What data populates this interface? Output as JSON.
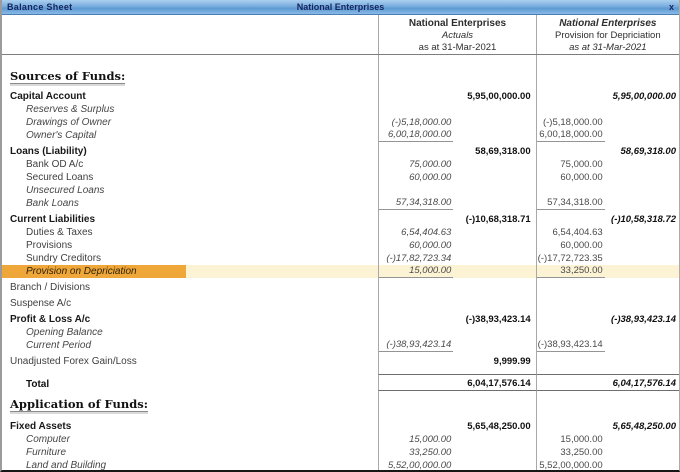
{
  "title_bar": {
    "left": "Balance Sheet",
    "center": "National Enterprises",
    "close": "x"
  },
  "columns": [
    {
      "line1": "National Enterprises",
      "line2": "Actuals",
      "line3": "as at 31-Mar-2021"
    },
    {
      "line1": "National Enterprises",
      "line2": "Provision for Depriciation",
      "line3": "as at 31-Mar-2021"
    }
  ],
  "colors": {
    "titlebar_blue": "#6aa2d8",
    "titlebar_text": "#16255d",
    "highlight_label_bg": "#f0a73a",
    "highlight_row_bg": "#fcf2d4",
    "grid_line": "#a8a8a8"
  },
  "rows": [
    {
      "label": "Sources of Funds:",
      "type": "section",
      "gap": 14
    },
    {
      "label": "Capital Account",
      "type": "group",
      "c1t": "5,95,00,000.00",
      "c2t": "5,95,00,000.00",
      "gap": 6
    },
    {
      "label": "Reserves & Surplus",
      "type": "ledger-italic",
      "gap": 0
    },
    {
      "label": "Drawings of Owner",
      "type": "ledger-italic",
      "c1d": "(-)5,18,000.00",
      "c2d": "(-)5,18,000.00",
      "gap": 0
    },
    {
      "label": "Owner's Capital",
      "type": "ledger-italic",
      "c1d": "6,00,18,000.00",
      "c2d": "6,00,18,000.00",
      "u": true,
      "gap": 0
    },
    {
      "label": "Loans (Liability)",
      "type": "group",
      "c1t": "58,69,318.00",
      "c2t": "58,69,318.00",
      "gap": 3
    },
    {
      "label": "Bank OD A/c",
      "type": "ledger",
      "c1d": "75,000.00",
      "c2d": "75,000.00",
      "gap": 0
    },
    {
      "label": "Secured Loans",
      "type": "ledger",
      "c1d": "60,000.00",
      "c2d": "60,000.00",
      "gap": 0
    },
    {
      "label": "Unsecured Loans",
      "type": "ledger-italic",
      "gap": 0
    },
    {
      "label": "Bank Loans",
      "type": "ledger-italic",
      "c1d": "57,34,318.00",
      "c2d": "57,34,318.00",
      "u": true,
      "gap": 0
    },
    {
      "label": "Current Liabilities",
      "type": "group",
      "c1t": "(-)10,68,318.71",
      "c2t": "(-)10,58,318.72",
      "gap": 3
    },
    {
      "label": "Duties & Taxes",
      "type": "ledger",
      "c1d": "6,54,404.63",
      "c2d": "6,54,404.63",
      "gap": 0
    },
    {
      "label": "Provisions",
      "type": "ledger",
      "c1d": "60,000.00",
      "c2d": "60,000.00",
      "gap": 0
    },
    {
      "label": "Sundry Creditors",
      "type": "ledger",
      "c1d": "(-)17,82,723.34",
      "c2d": "(-)17,72,723.35",
      "gap": 0
    },
    {
      "label": "Provision on Depriciation",
      "type": "ledger-italic",
      "c1d": "15,000.00",
      "c2d": "33,250.00",
      "u": true,
      "hl": true,
      "gap": 0
    },
    {
      "label": "Branch / Divisions",
      "type": "plain",
      "gap": 3
    },
    {
      "label": "Suspense A/c",
      "type": "plain",
      "gap": 3
    },
    {
      "label": "Profit & Loss A/c",
      "type": "group",
      "c1t": "(-)38,93,423.14",
      "c2t": "(-)38,93,423.14",
      "gap": 3
    },
    {
      "label": "Opening Balance",
      "type": "ledger-italic",
      "gap": 0
    },
    {
      "label": "Current Period",
      "type": "ledger-italic",
      "c1d": "(-)38,93,423.14",
      "c2d": "(-)38,93,423.14",
      "u": true,
      "gap": 0
    },
    {
      "label": "Unadjusted Forex Gain/Loss",
      "type": "plain",
      "c1t": "9,999.99",
      "gap": 3
    },
    {
      "label": "Total",
      "type": "total",
      "c1t": "6,04,17,576.14",
      "c2t": "6,04,17,576.14",
      "gap": 6
    },
    {
      "label": "Application of Funds:",
      "type": "section",
      "gap": 6
    },
    {
      "label": "Fixed Assets",
      "type": "group",
      "c1t": "5,65,48,250.00",
      "c2t": "5,65,48,250.00",
      "gap": 8
    },
    {
      "label": "Computer",
      "type": "ledger-italic",
      "c1d": "15,000.00",
      "c2d": "15,000.00",
      "gap": 0
    },
    {
      "label": "Furniture",
      "type": "ledger-italic",
      "c1d": "33,250.00",
      "c2d": "33,250.00",
      "gap": 0
    },
    {
      "label": "Land and Building",
      "type": "ledger-italic",
      "c1d": "5,52,00,000.00",
      "c2d": "5,52,00,000.00",
      "gap": 0
    }
  ]
}
